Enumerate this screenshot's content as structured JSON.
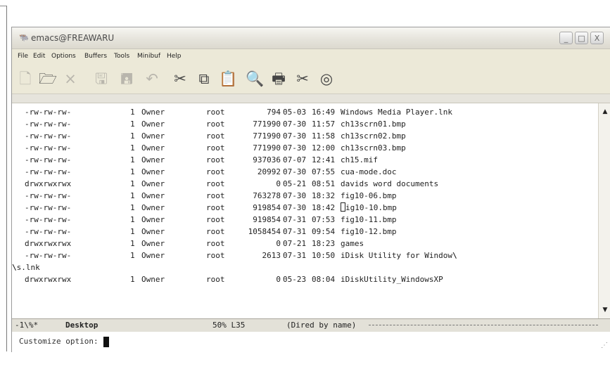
{
  "window": {
    "title": "emacs@FREAWARU",
    "buttons": {
      "minimize": "_",
      "maximize": "□",
      "close": "X"
    }
  },
  "menu": [
    "File",
    "Edit",
    "Options",
    "Buffers",
    "Tools",
    "Minibuf",
    "Help"
  ],
  "toolbar": [
    {
      "icon": "new-file-icon",
      "glyph": "🗋",
      "enabled": false
    },
    {
      "icon": "open-folder-icon",
      "glyph": "🗁",
      "enabled": true
    },
    {
      "icon": "close-icon",
      "glyph": "×",
      "enabled": false
    },
    {
      "icon": "save-icon",
      "glyph": "🖫",
      "enabled": false
    },
    {
      "icon": "save-as-icon",
      "glyph": "🖪",
      "enabled": false
    },
    {
      "icon": "undo-icon",
      "glyph": "↶",
      "enabled": false
    },
    {
      "icon": "cut-icon",
      "glyph": "✂",
      "enabled": true
    },
    {
      "icon": "copy-icon",
      "glyph": "⧉",
      "enabled": true
    },
    {
      "icon": "paste-icon",
      "glyph": "📋",
      "enabled": true
    },
    {
      "icon": "search-icon",
      "glyph": "🔍",
      "enabled": true
    },
    {
      "icon": "print-icon",
      "glyph": "🖶",
      "enabled": true
    },
    {
      "icon": "preferences-icon",
      "glyph": "✂",
      "enabled": true
    },
    {
      "icon": "help-icon",
      "glyph": "◎",
      "enabled": true
    }
  ],
  "dired": {
    "rows": [
      {
        "perm": "-rw-rw-rw-",
        "links": "1",
        "owner": "Owner",
        "group": "root",
        "size": "794",
        "date": "05-03",
        "time": "16:49",
        "name": "Windows Media Player.lnk"
      },
      {
        "perm": "-rw-rw-rw-",
        "links": "1",
        "owner": "Owner",
        "group": "root",
        "size": "771990",
        "date": "07-30",
        "time": "11:57",
        "name": "ch13scrn01.bmp"
      },
      {
        "perm": "-rw-rw-rw-",
        "links": "1",
        "owner": "Owner",
        "group": "root",
        "size": "771990",
        "date": "07-30",
        "time": "11:58",
        "name": "ch13scrn02.bmp"
      },
      {
        "perm": "-rw-rw-rw-",
        "links": "1",
        "owner": "Owner",
        "group": "root",
        "size": "771990",
        "date": "07-30",
        "time": "12:00",
        "name": "ch13scrn03.bmp"
      },
      {
        "perm": "-rw-rw-rw-",
        "links": "1",
        "owner": "Owner",
        "group": "root",
        "size": "937036",
        "date": "07-07",
        "time": "12:41",
        "name": "ch15.mif"
      },
      {
        "perm": "-rw-rw-rw-",
        "links": "1",
        "owner": "Owner",
        "group": "root",
        "size": "20992",
        "date": "07-30",
        "time": "07:55",
        "name": "cua-mode.doc"
      },
      {
        "perm": "drwxrwxrwx",
        "links": "1",
        "owner": "Owner",
        "group": "root",
        "size": "0",
        "date": "05-21",
        "time": "08:51",
        "name": "davids word documents"
      },
      {
        "perm": "-rw-rw-rw-",
        "links": "1",
        "owner": "Owner",
        "group": "root",
        "size": "763278",
        "date": "07-30",
        "time": "18:32",
        "name": "fig10-06.bmp"
      },
      {
        "perm": "-rw-rw-rw-",
        "links": "1",
        "owner": "Owner",
        "group": "root",
        "size": "919854",
        "date": "07-30",
        "time": "18:42",
        "name": "ig10-10.bmp",
        "cursor": true
      },
      {
        "perm": "-rw-rw-rw-",
        "links": "1",
        "owner": "Owner",
        "group": "root",
        "size": "919854",
        "date": "07-31",
        "time": "07:53",
        "name": "fig10-11.bmp"
      },
      {
        "perm": "-rw-rw-rw-",
        "links": "1",
        "owner": "Owner",
        "group": "root",
        "size": "1058454",
        "date": "07-31",
        "time": "09:54",
        "name": "fig10-12.bmp"
      },
      {
        "perm": "drwxrwxrwx",
        "links": "1",
        "owner": "Owner",
        "group": "root",
        "size": "0",
        "date": "07-21",
        "time": "18:23",
        "name": "games"
      },
      {
        "perm": "-rw-rw-rw-",
        "links": "1",
        "owner": "Owner",
        "group": "root",
        "size": "2613",
        "date": "07-31",
        "time": "10:50",
        "name": "iDisk Utility for Window"
      },
      {
        "wrap": "s.lnk"
      },
      {
        "perm": "drwxrwxrwx",
        "links": "1",
        "owner": "Owner",
        "group": "root",
        "size": "0",
        "date": "05-23",
        "time": "08:04",
        "name": "iDiskUtility_WindowsXP"
      }
    ],
    "wrap_glyph": "\\",
    "wrap_start_glyph": "\\"
  },
  "modeline": {
    "status": "-1\\%*",
    "buffer": "Desktop",
    "position": "50% L35",
    "mode": "(Dired by name)"
  },
  "minibuffer": {
    "prompt": "Customize option:",
    "value": ""
  }
}
